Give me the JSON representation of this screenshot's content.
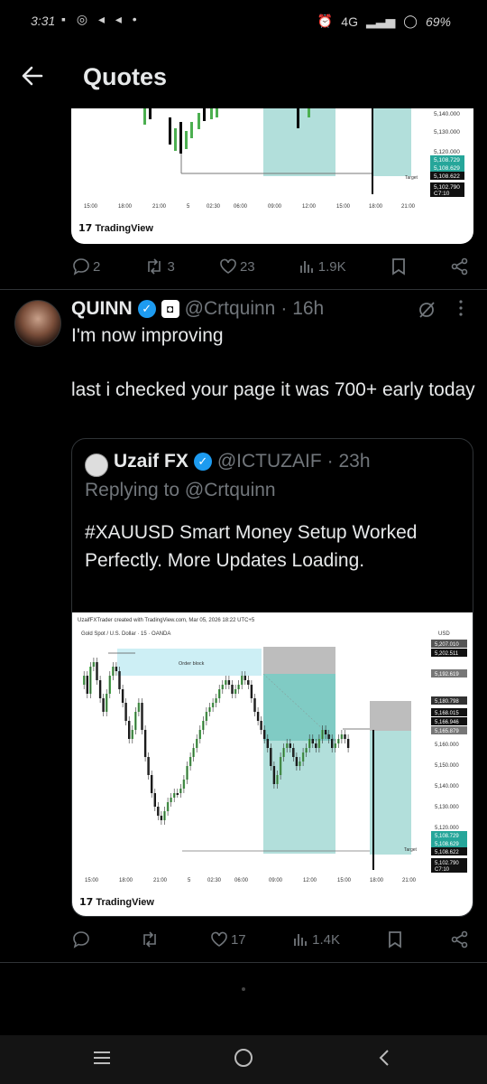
{
  "status_bar": {
    "time": "3:31",
    "network": "4G",
    "battery": "69%"
  },
  "header": {
    "title": "Quotes"
  },
  "prev_tweet": {
    "actions": {
      "replies": "2",
      "reposts": "3",
      "likes": "23",
      "views": "1.9K"
    }
  },
  "tweet": {
    "name": "QUINN",
    "handle": "@Crtquinn",
    "time": "· 16h",
    "text": "I'm now improving\n\nlast i checked your page it was 700+ early today",
    "actions": {
      "replies": "",
      "reposts": "",
      "likes": "17",
      "views": "1.4K"
    }
  },
  "quoted": {
    "name": "Uzaif FX",
    "handle": "@ICTUZAIF",
    "time": "· 23h",
    "reply_to": "Replying to @Crtquinn",
    "text": "#XAUUSD Smart Money Setup Worked Perfectly. More Updates Loading."
  },
  "chart_texts": {
    "header": "UzaifFXTrader created with TradingView.com, Mar 05, 2026 18:22 UTC+5",
    "instrument": "Gold Spot / U.S. Dollar · 15 · OANDA",
    "currency": "USD",
    "order_block": "Order block",
    "target": "Target",
    "logo": "TradingView",
    "x_ticks": [
      "15:00",
      "18:00",
      "21:00",
      "5",
      "02:30",
      "06:00",
      "09:00",
      "12:00",
      "15:00",
      "18:00",
      "21:00"
    ],
    "y_ticks": [
      "5,207.010",
      "5,202.511",
      "5,192.619",
      "5,180.798",
      "5,168.015",
      "5,166.946",
      "5,165.879",
      "5,160.000",
      "5,150.000",
      "5,140.000",
      "5,130.000",
      "5,120.000",
      "5,108.729",
      "5,108.629",
      "5,108.622",
      "5,102.790",
      "C7:10"
    ],
    "prev_y_ticks": [
      "5,140.000",
      "5,130.000",
      "5,120.000",
      "5,108.729",
      "5,108.629",
      "5,108.622",
      "5,102.790",
      "C7:10"
    ]
  },
  "colors": {
    "background": "#000000",
    "text": "#e7e9ea",
    "muted": "#71767b",
    "verified": "#1d9bf0",
    "bull": "#4caf50",
    "teal_zone": "#b2dfdb",
    "order_block": "#cdeff5",
    "target_green": "#26a69a"
  },
  "icons": {
    "back": "arrow-left-icon",
    "reply": "reply-icon",
    "repost": "repost-icon",
    "like": "heart-icon",
    "views": "views-icon",
    "bookmark": "bookmark-icon",
    "share": "share-icon",
    "grok": "grok-icon",
    "more": "more-icon"
  }
}
